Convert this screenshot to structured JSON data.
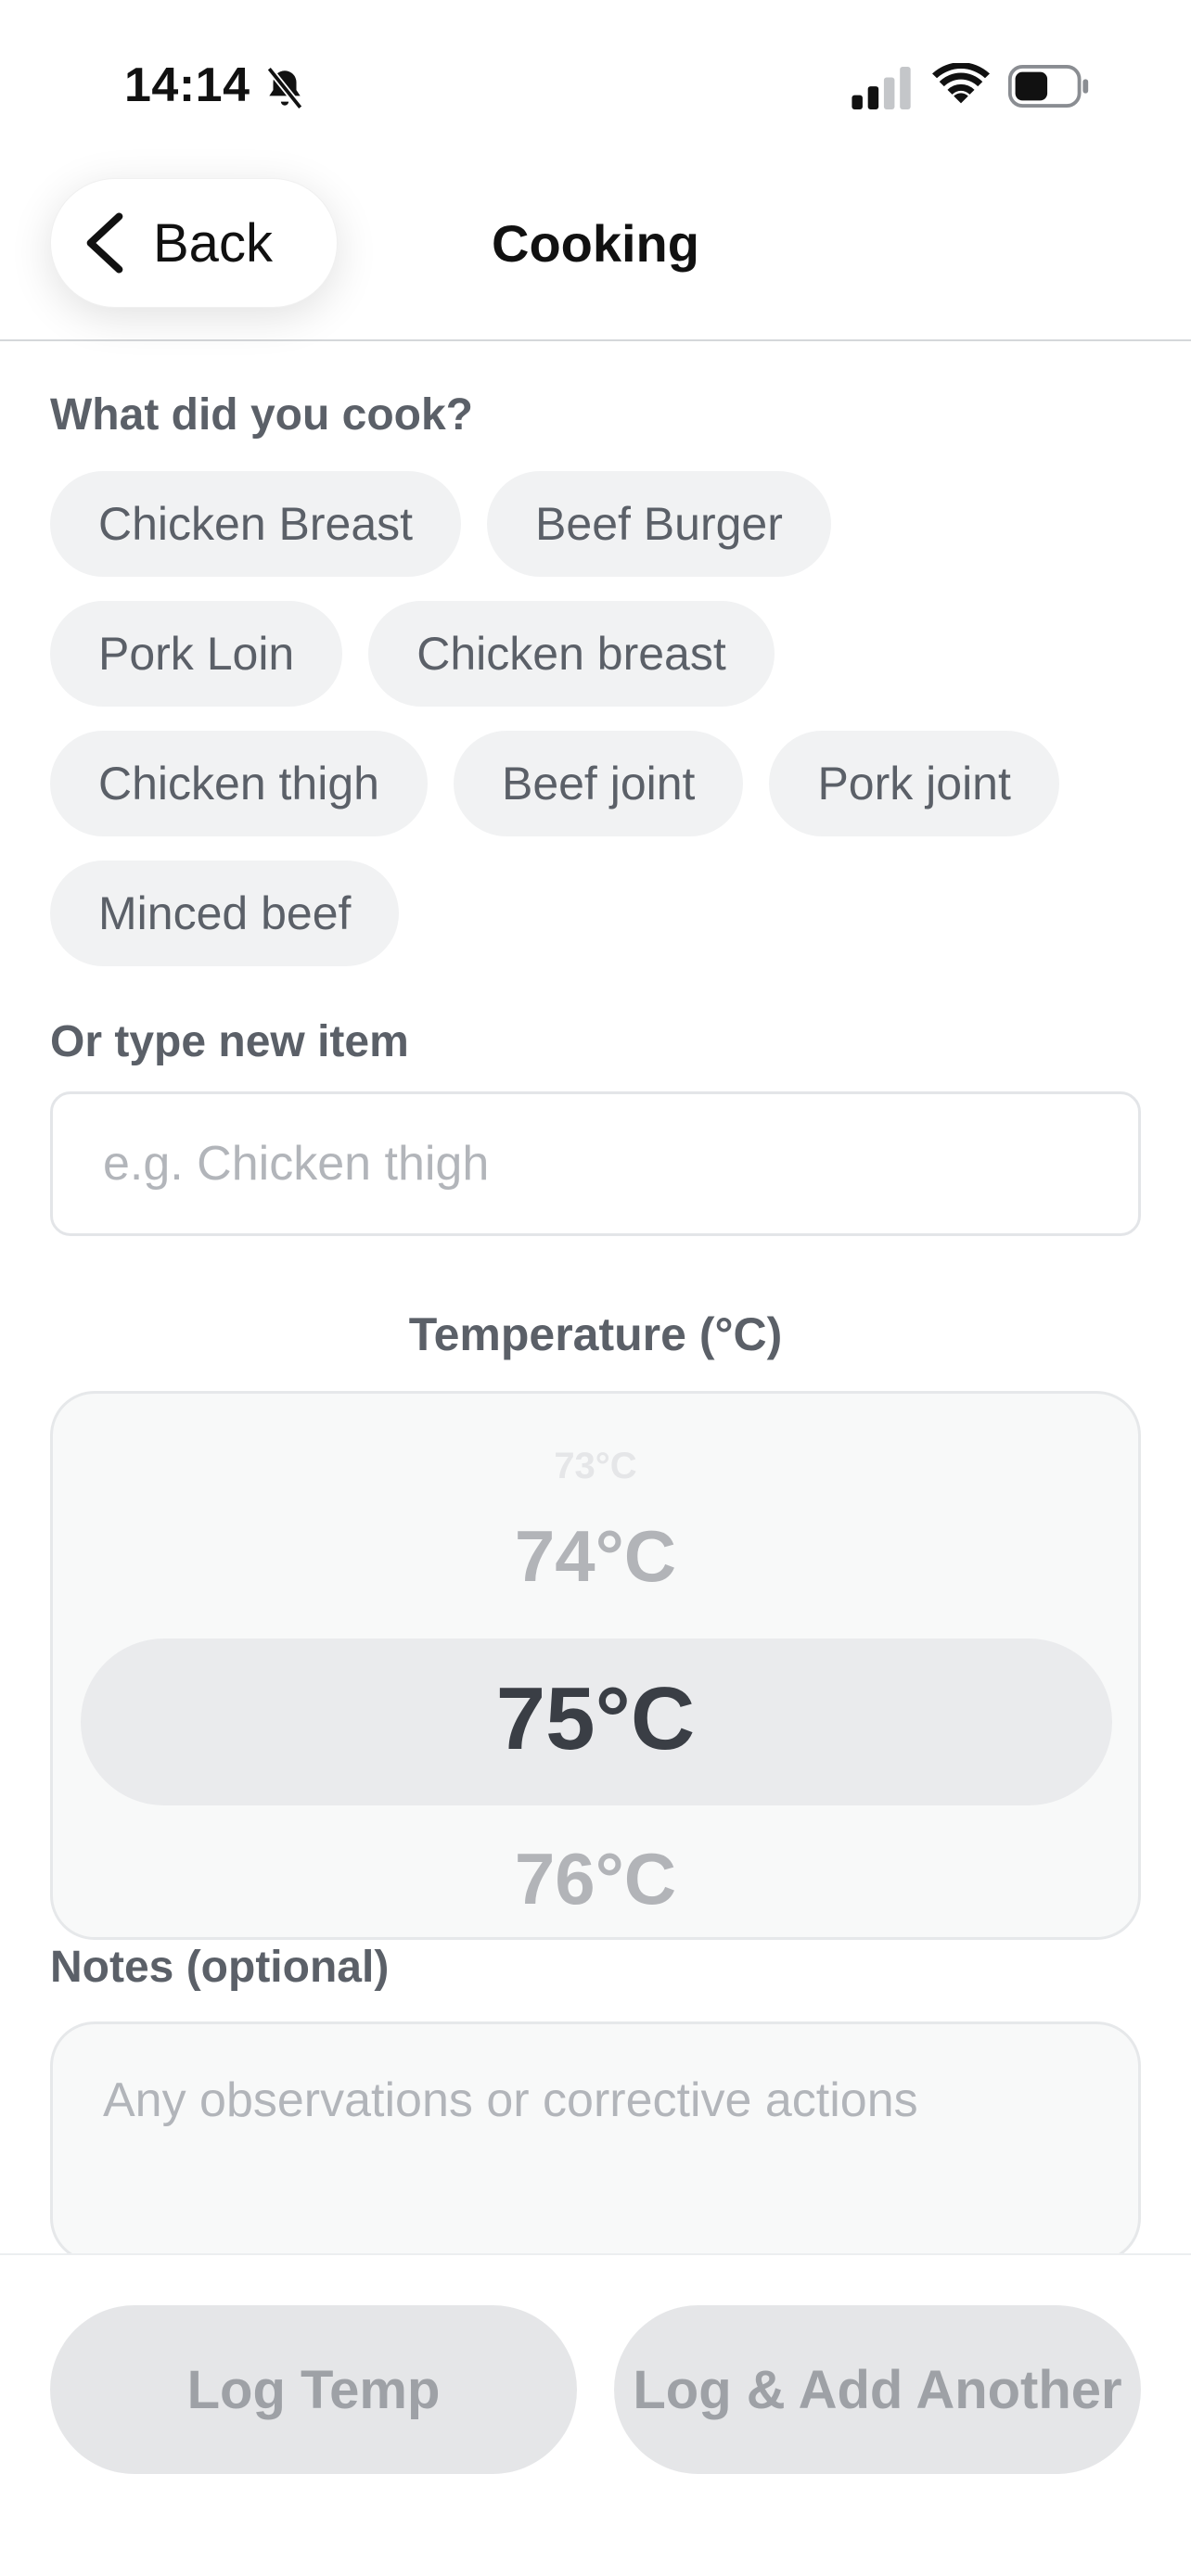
{
  "status_bar": {
    "time": "14:14",
    "icons": [
      "bell-slash-icon",
      "cellular-signal-icon",
      "wifi-icon",
      "battery-icon"
    ]
  },
  "header": {
    "back_label": "Back",
    "title": "Cooking"
  },
  "food": {
    "label": "What did you cook?",
    "chip_rows": [
      [
        "Chicken Breast",
        "Beef Burger"
      ],
      [
        "Pork Loin",
        "Chicken breast"
      ],
      [
        "Chicken thigh",
        "Beef joint",
        "Pork joint"
      ],
      [
        "Minced beef"
      ]
    ]
  },
  "new_item": {
    "label": "Or type new item",
    "placeholder": "e.g. Chicken thigh",
    "value": ""
  },
  "temperature": {
    "label": "Temperature (°C)",
    "options": [
      "73°C",
      "74°C",
      "75°C",
      "76°C"
    ],
    "selected": "75°C"
  },
  "notes": {
    "label": "Notes (optional)",
    "placeholder": "Any observations or corrective actions",
    "value": ""
  },
  "footer": {
    "log_label": "Log Temp",
    "log_add_label": "Log & Add Another"
  },
  "colors": {
    "chip_bg": "#f1f2f3",
    "button_disabled_bg": "#e5e6e8",
    "muted_text": "#5b6068"
  }
}
